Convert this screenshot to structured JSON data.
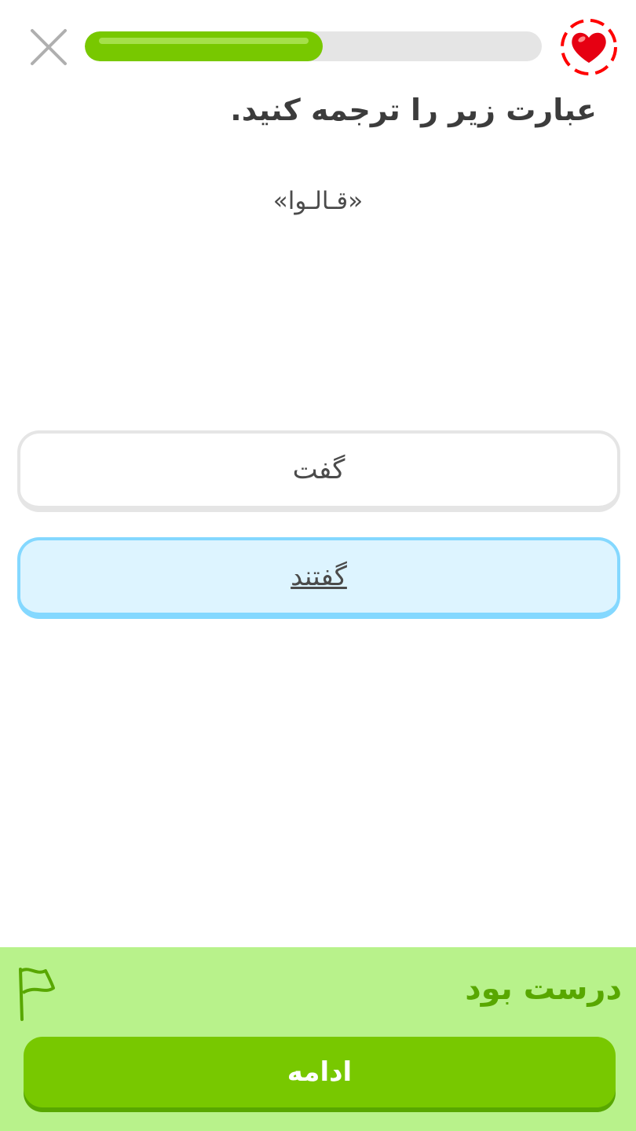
{
  "header": {
    "close_icon": "close-icon",
    "progress": 0.52,
    "heart_icon": "heart-icon",
    "accent_color": "#78c800"
  },
  "challenge": {
    "instruction": "عبارت زیر را ترجمه کنید.",
    "prompt": "«قـالـوا»"
  },
  "options": [
    {
      "label": "گفت",
      "selected": false
    },
    {
      "label": "گفتند",
      "selected": true
    }
  ],
  "feedback": {
    "title": "درست بود",
    "flag_icon": "flag-icon",
    "continue_label": "ادامه",
    "background_color": "#b8f28b",
    "text_color": "#58a700"
  }
}
